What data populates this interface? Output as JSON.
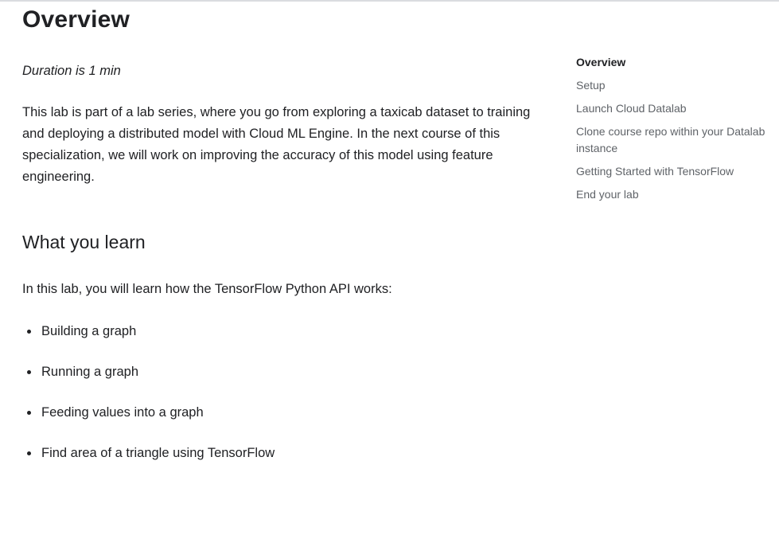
{
  "main": {
    "title": "Overview",
    "duration": "Duration is 1 min",
    "intro": "This lab is part of a lab series, where you go from exploring a taxicab dataset to training and deploying a distributed model with Cloud ML Engine. In the next course of this specialization, we will work on improving the accuracy of this model using feature engineering.",
    "learn_section": {
      "title": "What you learn",
      "intro": "In this lab, you will learn how the TensorFlow Python API works:",
      "items": [
        "Building a graph",
        "Running a graph",
        "Feeding values into a graph",
        "Find area of a triangle using TensorFlow"
      ]
    }
  },
  "toc": {
    "active_index": 0,
    "items": [
      "Overview",
      "Setup",
      "Launch Cloud Datalab",
      "Clone course repo within your Datalab instance",
      "Getting Started with TensorFlow",
      "End your lab"
    ]
  }
}
